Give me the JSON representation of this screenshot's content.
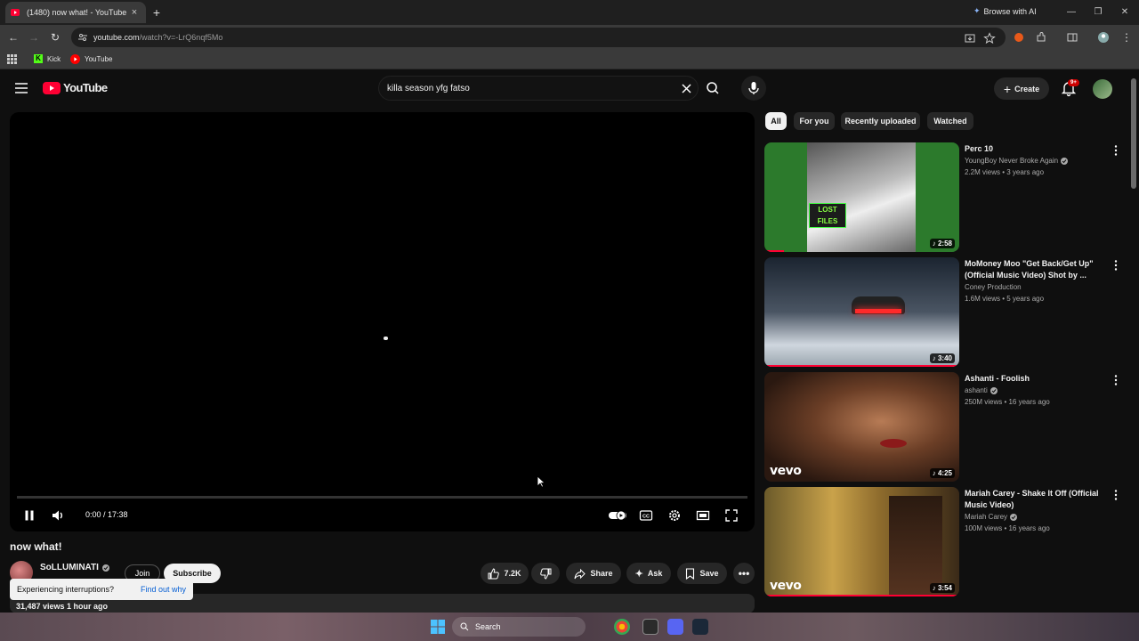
{
  "browser": {
    "tab_title": "(1480) now what! - YouTube",
    "tab_close": "×",
    "new_tab": "+",
    "browse_ai": "Browse with AI",
    "url_domain": "youtube.com",
    "url_path": "/watch?v=-LrQ6nqf5Mo",
    "bookmarks": [
      {
        "label": "Kick",
        "icon": "kick-icon",
        "color": "#53fc18"
      },
      {
        "label": "YouTube",
        "icon": "youtube-icon",
        "color": "#ff0000"
      }
    ]
  },
  "youtube": {
    "logo_text": "YouTube",
    "search_value": "killa season yfg fatso",
    "create_label": "Create",
    "notification_badge": "9+"
  },
  "player": {
    "time": "0:00 / 17:38",
    "progress": 0.0
  },
  "video": {
    "title": "now what!",
    "channel": "SoLLUMINATI",
    "join_label": "Join",
    "subscribe_label": "Subscribe",
    "likes": "7.2K",
    "share_label": "Share",
    "ask_label": "Ask",
    "save_label": "Save",
    "interruption_text": "Experiencing interruptions?",
    "interruption_link": "Find out why",
    "views_age": "31,487 views  1 hour ago"
  },
  "chips": [
    {
      "label": "All",
      "active": true
    },
    {
      "label": "For you",
      "active": false
    },
    {
      "label": "Recently uploaded",
      "active": false
    },
    {
      "label": "Watched",
      "active": false
    }
  ],
  "recommendations": [
    {
      "title": "Perc 10",
      "channel": "YoungBoy Never Broke Again",
      "verified": true,
      "meta": "2.2M views • 3 years ago",
      "duration": "2:58",
      "music": true,
      "vevo": false,
      "watched": 0.1,
      "thumb_text": "LOST FILES"
    },
    {
      "title": "MoMoney Moo \"Get Back/Get Up\" (Official Music Video) Shot by ...",
      "channel": "Coney Production",
      "verified": false,
      "meta": "1.6M views • 5 years ago",
      "duration": "3:40",
      "music": true,
      "vevo": false,
      "watched": 1.0
    },
    {
      "title": "Ashanti - Foolish",
      "channel": "ashanti",
      "verified": true,
      "meta": "250M views • 16 years ago",
      "duration": "4:25",
      "music": true,
      "vevo": true,
      "watched": 0.0
    },
    {
      "title": "Mariah Carey - Shake It Off (Official Music Video)",
      "channel": "Mariah Carey",
      "verified": true,
      "meta": "100M views • 16 years ago",
      "duration": "3:54",
      "music": true,
      "vevo": true,
      "watched": 1.0
    }
  ],
  "taskbar": {
    "search_label": "Search"
  },
  "colors": {
    "youtube_red": "#ff0033",
    "background": "#0f0f0f",
    "link_blue": "#065fd4"
  }
}
